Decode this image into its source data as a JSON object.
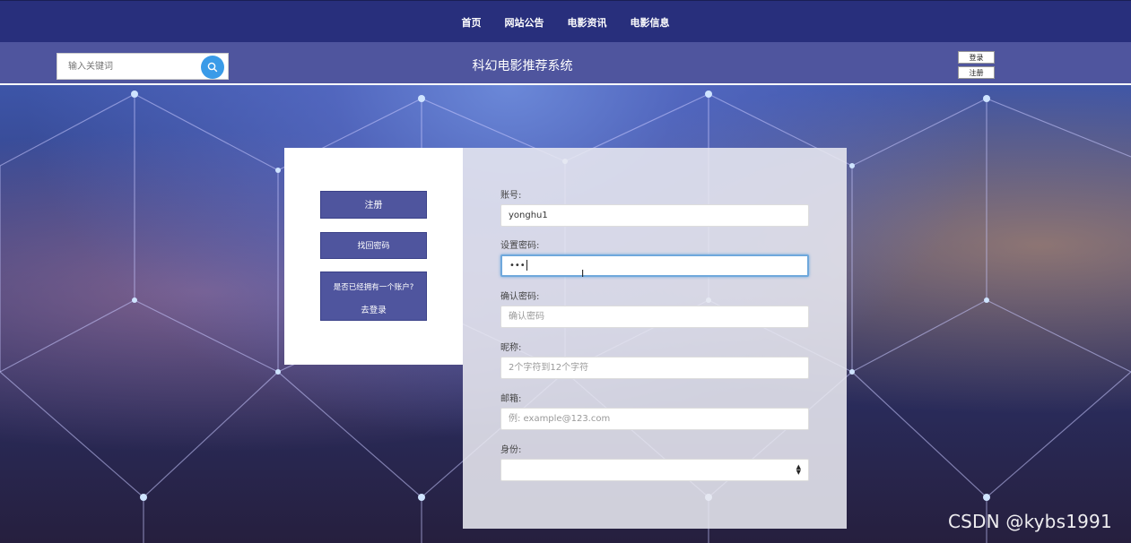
{
  "topnav": {
    "items": [
      {
        "label": "首页"
      },
      {
        "label": "网站公告"
      },
      {
        "label": "电影资讯"
      },
      {
        "label": "电影信息"
      }
    ]
  },
  "header": {
    "search_placeholder": "输入关键词",
    "search_icon": "search-icon",
    "site_title": "科幻电影推荐系统",
    "login_label": "登录",
    "register_label": "注册"
  },
  "left_panel": {
    "register_label": "注册",
    "find_password_label": "找回密码",
    "have_account_text": "是否已经拥有一个账户?",
    "go_login_label": "去登录"
  },
  "form": {
    "account_label": "账号:",
    "account_value": "yonghu1",
    "password_label": "设置密码:",
    "password_value": "•••",
    "confirm_label": "确认密码:",
    "confirm_placeholder": "确认密码",
    "nickname_label": "昵称:",
    "nickname_placeholder": "2个字符到12个字符",
    "email_label": "邮箱:",
    "email_placeholder": "例: example@123.com",
    "identity_label": "身份:",
    "identity_value": ""
  },
  "watermark": "CSDN @kybs1991",
  "colors": {
    "nav_bg": "#282f7c",
    "header_bg": "#4f559e",
    "button_bg": "#4f559e",
    "search_btn": "#3a9be8"
  }
}
